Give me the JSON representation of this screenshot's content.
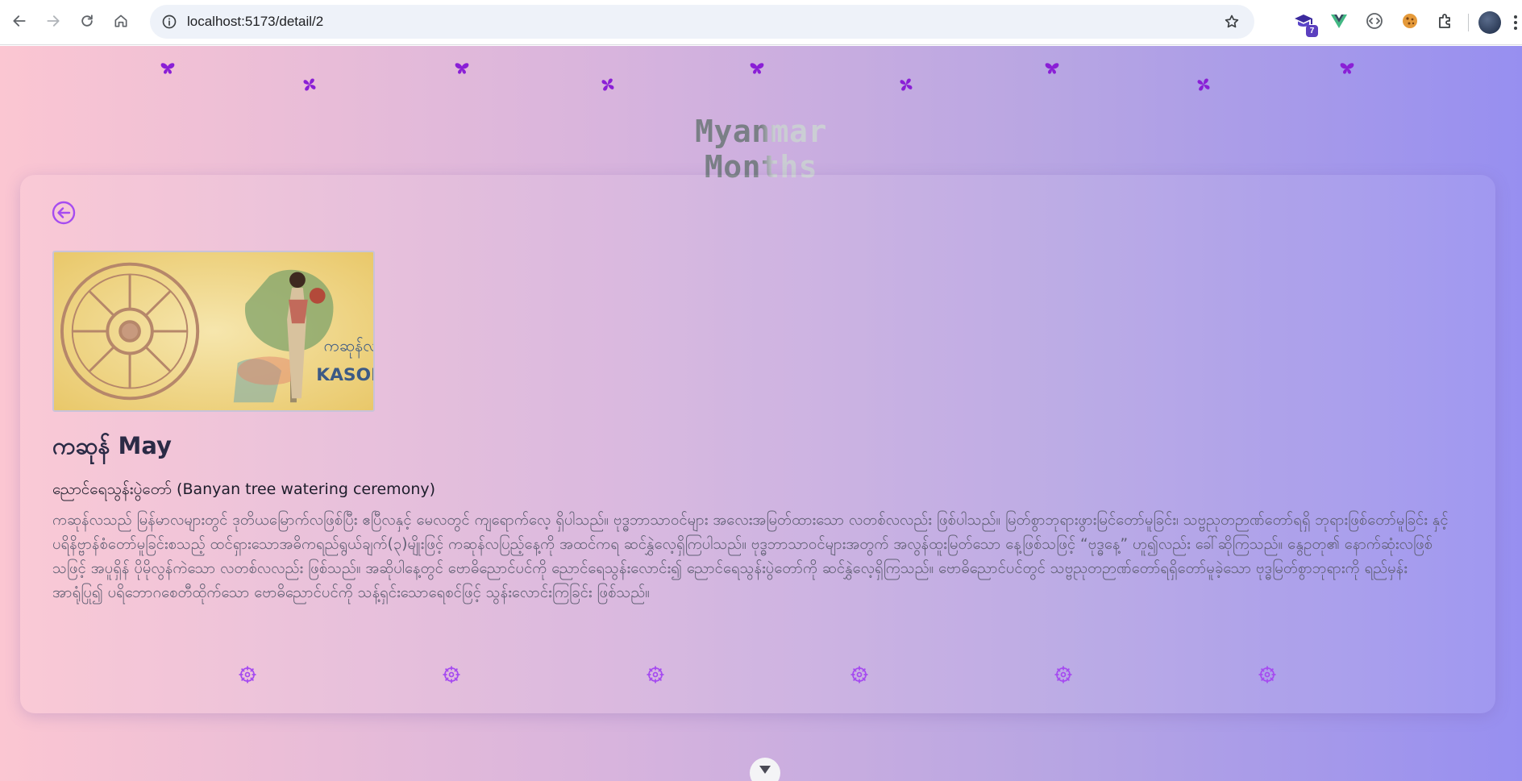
{
  "browser": {
    "url": "localhost:5173/detail/2",
    "extension_badge": "7",
    "icons": {
      "back": "arrow-left-icon",
      "forward": "arrow-right-icon",
      "reload": "reload-icon",
      "home": "home-icon",
      "site_info": "info-icon",
      "bookmark": "star-icon",
      "extensions": [
        "graduation-cap-icon",
        "vue-logo-icon",
        "code-bracket-icon",
        "cookie-icon",
        "puzzle-icon"
      ],
      "profile": "avatar",
      "menu": "more-vert-icon"
    }
  },
  "page": {
    "title": "Myanmar Months",
    "colors": {
      "gradient_start": "#fbc6d2",
      "gradient_end": "#978ff0",
      "accent": "#a64cf0",
      "decor": "#8a1fd6"
    },
    "decorations": {
      "top_icons": [
        "butterfly-icon",
        "pinwheel-icon",
        "butterfly-icon",
        "pinwheel-icon",
        "butterfly-icon",
        "pinwheel-icon",
        "butterfly-icon",
        "pinwheel-icon",
        "butterfly-icon"
      ],
      "bottom_icons": [
        "dharma-wheel-icon",
        "dharma-wheel-icon",
        "dharma-wheel-icon",
        "dharma-wheel-icon",
        "dharma-wheel-icon",
        "dharma-wheel-icon"
      ]
    }
  },
  "detail": {
    "back_icon": "arrow-left-circle-icon",
    "image": {
      "label_my": "ကဆုန်လ",
      "label_en": "KASON"
    },
    "heading": "ကဆုန် May",
    "festival": "ညောင်ရေသွန်းပွဲတော် (Banyan tree watering ceremony)",
    "description": "ကဆုန်လသည် မြန်မာလများတွင် ဒုတိယမြောက်လဖြစ်ပြီး ဧပြီလနှင့် မေလတွင် ကျရောက်လေ့ ရှိပါသည်။ ဗုဒ္ဓဘာသာဝင်များ အလေးအမြတ်ထားသော လတစ်လလည်း ဖြစ်ပါသည်။ မြတ်စွာဘုရားဖွားမြင်တော်မူခြင်း၊ သဗ္ဗညုတဉာဏ်တော်ရရှိ ဘုရားဖြစ်တော်မူခြင်း နှင့် ပရိနိဗ္ဗာန်စံတော်မူခြင်းစသည့် ထင်ရှားသောအဓိကရည်ရွယ်ချက်(၃)မျိုးဖြင့် ကဆုန်လပြည့်နေ့ကို အထင်ကရ ဆင်နွှဲလေ့ရှိကြပါသည်။ ဗုဒ္ဓဘာသာဝင်များအတွက် အလွန်ထူးမြတ်သော နေ့ဖြစ်သဖြင့် “ဗုဒ္ဓနေ့” ဟူ၍လည်း ခေါ်ဆိုကြသည်။ နွေဥတု၏ နောက်ဆုံးလဖြစ်သဖြင့် အပူရှိန် ပိုမိုလွန်ကဲသော လတစ်လလည်း ဖြစ်သည်။ အဆိုပါနေ့တွင် ဗောဓိညောင်ပင်ကို ညောင်ရေသွန်းလောင်း၍ ညောင်ရေသွန်းပွဲတော်ကို ဆင်နွှဲလေ့ရှိကြသည်။ ဗောဓိညောင်ပင်တွင် သဗ္ဗညုတဉာဏ်တော်ရရှိတော်မူခဲ့သော ဗုဒ္ဓမြတ်စွာဘုရားကို ရည်မှန်း အာရုံပြု၍ ပရိဘောဂစေတီထိုက်သော ဗောဓိညောင်ပင်ကို သန့်ရှင်းသောရေစင်ဖြင့် သွန်းလောင်းကြခြင်း ဖြစ်သည်။",
    "scroll_icon": "chevron-down-icon"
  }
}
